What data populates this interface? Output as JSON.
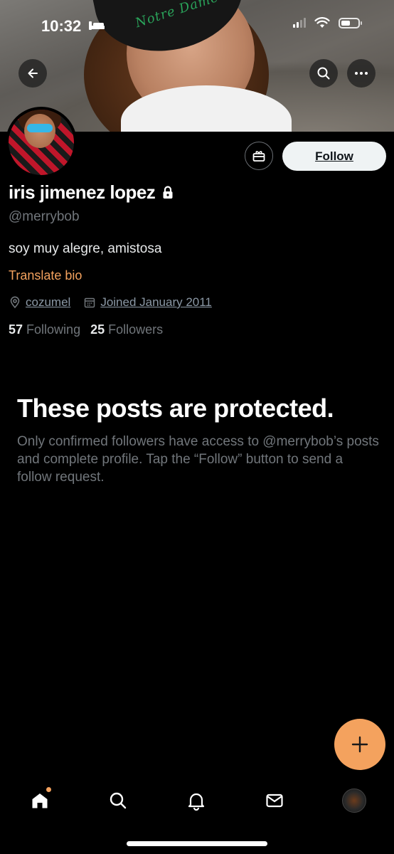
{
  "status_bar": {
    "time": "10:32"
  },
  "banner": {
    "cap_text": "Notre Dame"
  },
  "header_actions": {
    "back": "back-icon",
    "search": "search-icon",
    "more": "more-icon"
  },
  "profile": {
    "follow_label": "Follow",
    "name": "iris jimenez lopez",
    "handle": "@merrybob",
    "bio": "soy muy alegre, amistosa",
    "translate_label": "Translate bio",
    "location": "cozumel",
    "joined": "Joined January 2011",
    "following_count": "57",
    "following_label": "Following",
    "followers_count": "25",
    "followers_label": "Followers"
  },
  "protected": {
    "title": "These posts are protected.",
    "message": "Only confirmed followers have access to @merrybob’s posts and complete profile. Tap the “Follow” button to send a follow request."
  },
  "tabbar": {
    "items": [
      "home-icon",
      "search-icon",
      "notifications-icon",
      "messages-icon",
      "profile-avatar"
    ]
  },
  "colors": {
    "accent": "#f4a25e",
    "background": "#000000",
    "secondary_text": "#71767b"
  }
}
